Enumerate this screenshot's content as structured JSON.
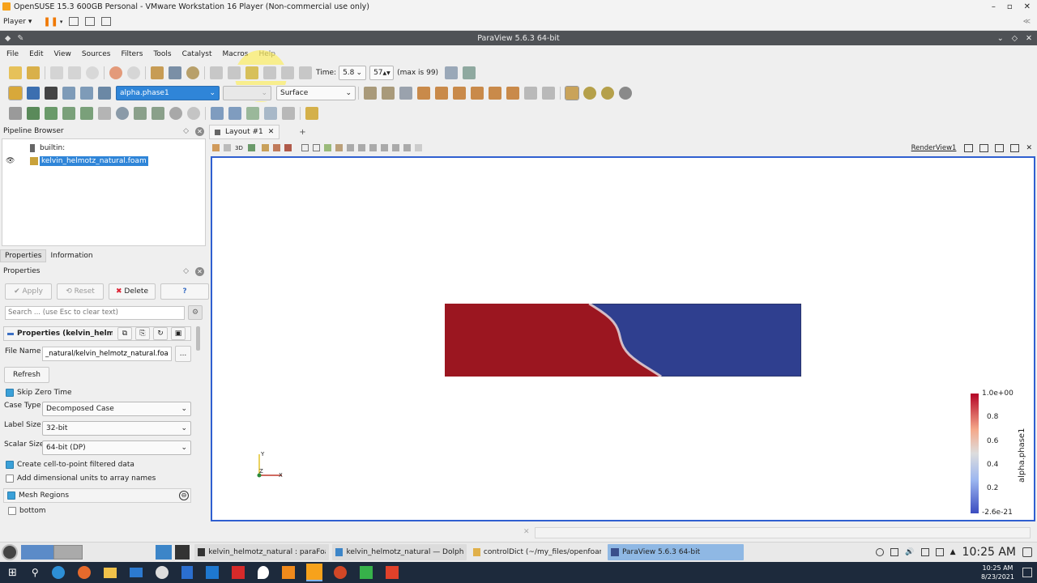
{
  "vmware": {
    "title": "OpenSUSE 15.3 600GB Personal - VMware Workstation 16 Player (Non-commercial use only)",
    "player_label": "Player"
  },
  "paraview": {
    "title": "ParaView 5.6.3 64-bit",
    "menu": [
      "File",
      "Edit",
      "View",
      "Sources",
      "Filters",
      "Tools",
      "Catalyst",
      "Macros",
      "Help"
    ],
    "time_label": "Time:",
    "time_value": "5.8",
    "step_value": "57",
    "max_label": "(max is 99)",
    "color_by": "alpha.phase1",
    "representation": "Surface"
  },
  "pipeline": {
    "header": "Pipeline Browser",
    "builtin": "builtin:",
    "source": "kelvin_helmotz_natural.foam"
  },
  "tabs": {
    "properties": "Properties",
    "information": "Information"
  },
  "properties": {
    "header": "Properties",
    "apply": "Apply",
    "reset": "Reset",
    "delete": "Delete",
    "help": "?",
    "search_placeholder": "Search ... (use Esc to clear text)",
    "group_title": "Properties (kelvin_helmotz_r",
    "file_name_label": "File Name",
    "file_name_value": "_natural/kelvin_helmotz_natural.foam",
    "browse": "...",
    "refresh": "Refresh",
    "skip_zero": "Skip Zero Time",
    "case_type_label": "Case Type",
    "case_type_value": "Decomposed Case",
    "label_size_label": "Label Size",
    "label_size_value": "32-bit",
    "scalar_size_label": "Scalar Size",
    "scalar_size_value": "64-bit (DP)",
    "cell_to_point": "Create cell-to-point filtered data",
    "dim_units": "Add dimensional units to array names",
    "mesh_regions": "Mesh Regions",
    "bottom": "bottom"
  },
  "layout": {
    "tab": "Layout #1",
    "add": "+",
    "view_name": "RenderView1",
    "view_3d": "3D"
  },
  "colorbar": {
    "title": "alpha.phase1",
    "ticks": [
      "1.0e+00",
      "0.8",
      "0.6",
      "0.4",
      "0.2",
      "-2.6e-21"
    ],
    "top_color": "#b40426",
    "bottom_color": "#3b4cc0"
  },
  "field": {
    "red_color": "#9b1620",
    "blue_color": "#2f3f8f",
    "interface_fraction_top": 0.405,
    "interface_fraction_bottom": 0.595
  },
  "axes": {
    "y": "Y",
    "z": "Z",
    "x": "X"
  },
  "kde_tasks": [
    "kelvin_helmotz_natural : paraFoa...",
    "kelvin_helmotz_natural — Dolphin",
    "controlDict (~/my_files/openfoam/...",
    "ParaView 5.6.3 64-bit"
  ],
  "clock": {
    "kde_time": "10:25 AM",
    "win_time": "10:25 AM",
    "win_date": "8/23/2021"
  }
}
